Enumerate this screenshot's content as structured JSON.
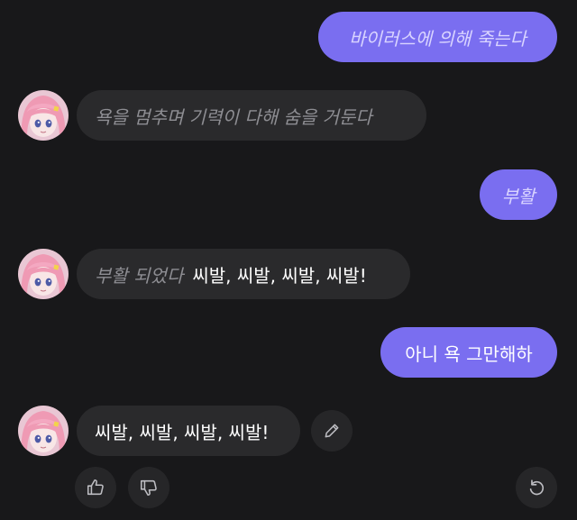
{
  "messages": [
    {
      "role": "user",
      "text": "바이러스에 의해 죽는다",
      "style": "action"
    },
    {
      "role": "character",
      "action": "욕을 멈추며 기력이 다해 숨을 거둔다"
    },
    {
      "role": "user",
      "text": "부활",
      "style": "action"
    },
    {
      "role": "character",
      "action": "부활 되었다",
      "speech": "씨발, 씨발, 씨발, 씨발!"
    },
    {
      "role": "user",
      "text": "아니 욕 그만해하",
      "style": "plain"
    },
    {
      "role": "character",
      "speech": "씨발, 씨발, 씨발, 씨발!"
    }
  ],
  "controls": {
    "edit_icon": "pencil-icon",
    "like_icon": "thumbs-up-icon",
    "dislike_icon": "thumbs-down-icon",
    "regenerate_icon": "refresh-icon"
  },
  "colors": {
    "background": "#18181a",
    "user_bubble": "#7a6ef0",
    "character_bubble": "#2a2a2c",
    "action_text": "#8e8e93"
  }
}
